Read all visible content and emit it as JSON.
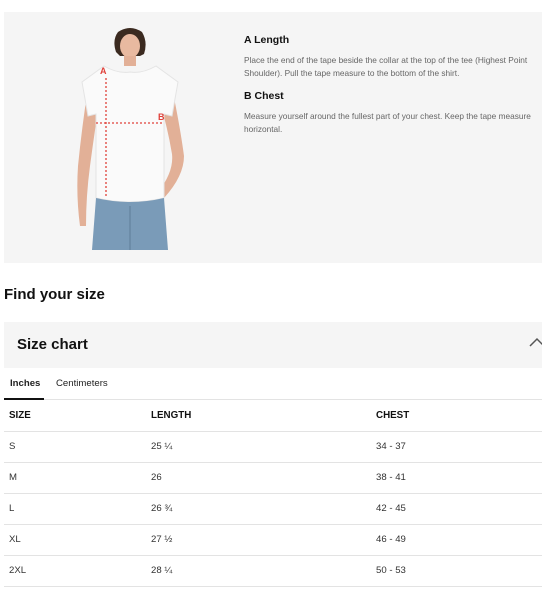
{
  "measure_guide": {
    "markers": {
      "a": "A",
      "b": "B"
    },
    "items": [
      {
        "title": "A Length",
        "description": "Place the end of the tape beside the collar at the top of the tee (Highest Point Shoulder). Pull the tape measure to the bottom of the shirt."
      },
      {
        "title": "B Chest",
        "description": "Measure yourself around the fullest part of your chest. Keep the tape measure horizontal."
      }
    ]
  },
  "find_size_heading": "Find your size",
  "size_chart": {
    "title": "Size chart",
    "tabs": [
      {
        "label": "Inches",
        "active": true
      },
      {
        "label": "Centimeters",
        "active": false
      }
    ],
    "columns": [
      "SIZE",
      "LENGTH",
      "CHEST"
    ],
    "rows": [
      [
        "S",
        "25 ¼",
        "34 - 37"
      ],
      [
        "M",
        "26",
        "38 - 41"
      ],
      [
        "L",
        "26 ¾",
        "42 - 45"
      ],
      [
        "XL",
        "27 ½",
        "46 - 49"
      ],
      [
        "2XL",
        "28 ¼",
        "50 - 53"
      ]
    ]
  },
  "colors": {
    "panel_bg": "#f5f5f5",
    "measure_line": "#e0413a",
    "text_muted": "#666666"
  }
}
